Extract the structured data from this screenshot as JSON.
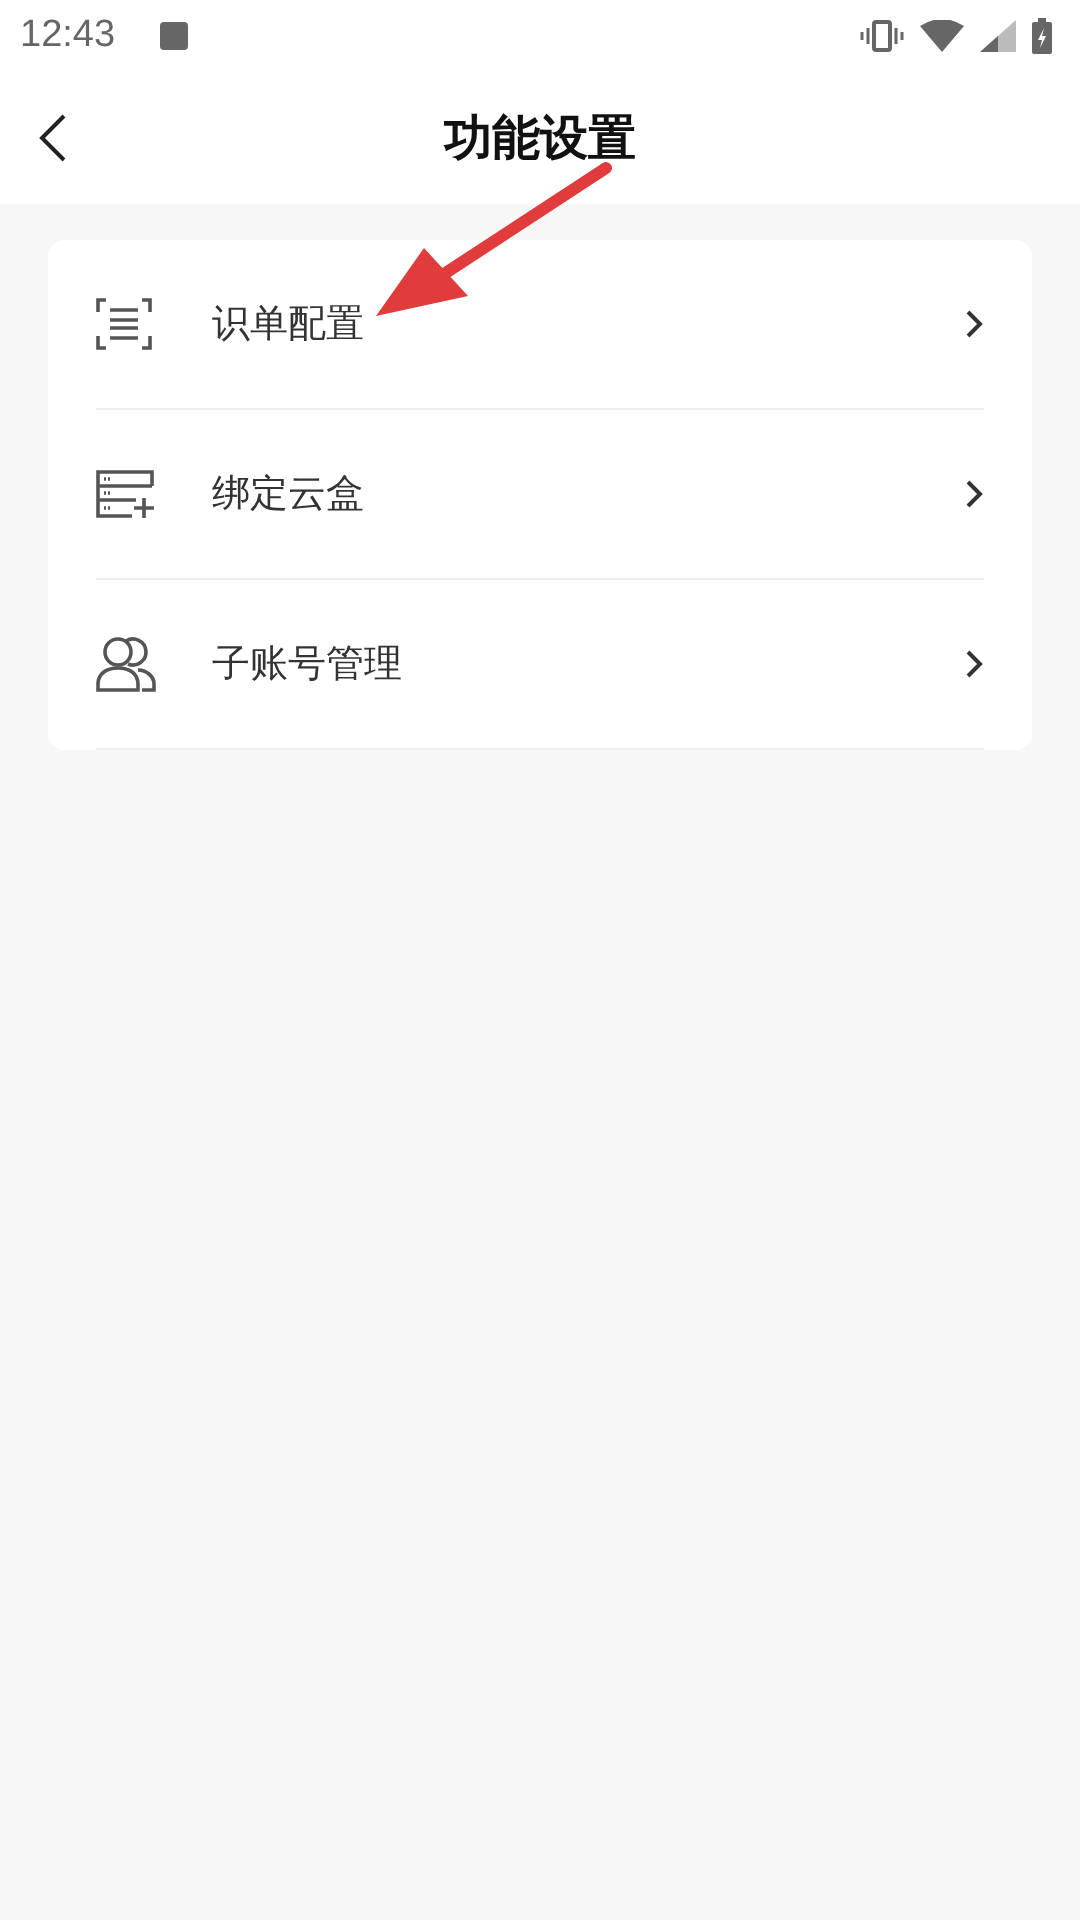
{
  "status_bar": {
    "time": "12:43"
  },
  "header": {
    "title": "功能设置"
  },
  "menu": [
    {
      "label": "识单配置"
    },
    {
      "label": "绑定云盒"
    },
    {
      "label": "子账号管理"
    }
  ]
}
